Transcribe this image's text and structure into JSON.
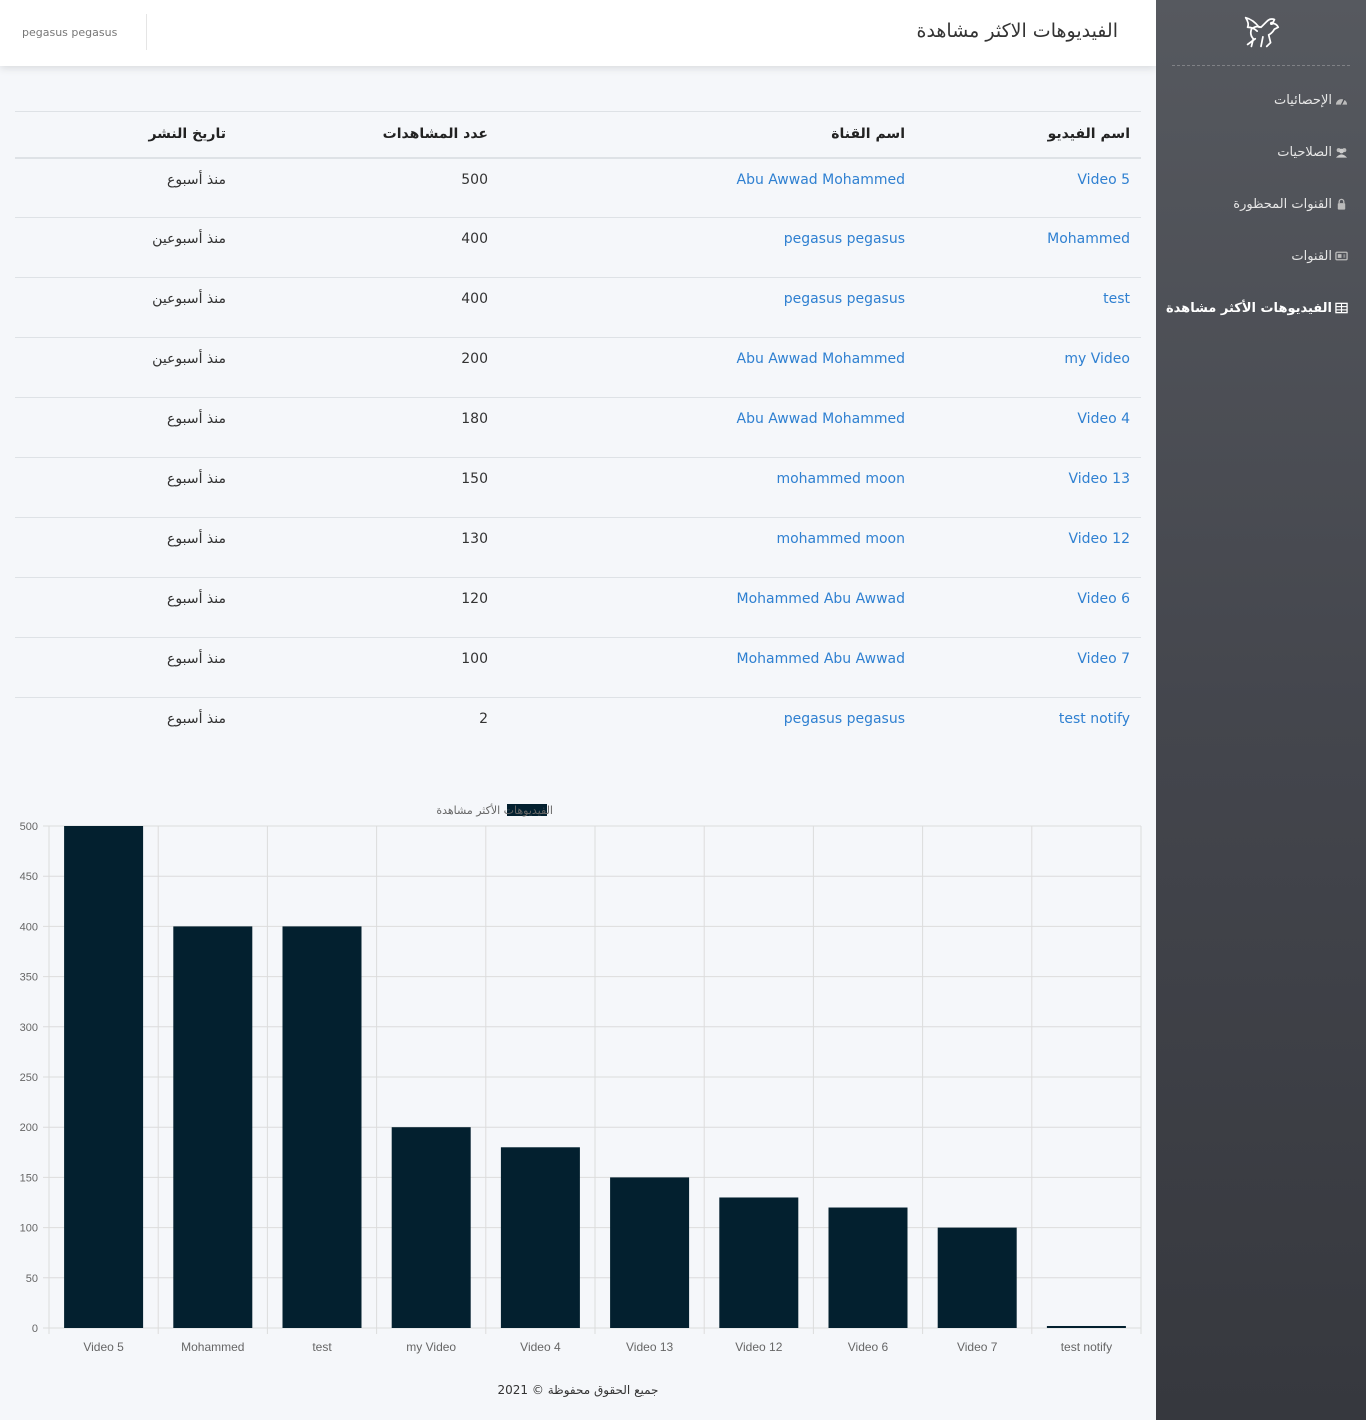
{
  "header": {
    "title": "الفيديوهات الاكثر مشاهدة",
    "user": "pegasus pegasus"
  },
  "sidebar": {
    "items": [
      {
        "label": "الإحصائيات",
        "icon": "dashboard-icon",
        "active": false
      },
      {
        "label": "الصلاحيات",
        "icon": "users-icon",
        "active": false
      },
      {
        "label": "القنوات المحظورة",
        "icon": "lock-icon",
        "active": false
      },
      {
        "label": "القنوات",
        "icon": "tv-icon",
        "active": false
      },
      {
        "label": "الفيديوهات الأكثر مشاهدة",
        "icon": "table-icon",
        "active": true
      }
    ]
  },
  "table": {
    "headers": [
      "اسم الفيديو",
      "اسم القناة",
      "عدد المشاهدات",
      "تاريخ النشر"
    ],
    "rows": [
      {
        "video": "Video 5",
        "channel": "Abu Awwad Mohammed",
        "views": "500",
        "date": "منذ أسبوع"
      },
      {
        "video": "Mohammed",
        "channel": "pegasus pegasus",
        "views": "400",
        "date": "منذ أسبوعين"
      },
      {
        "video": "test",
        "channel": "pegasus pegasus",
        "views": "400",
        "date": "منذ أسبوعين"
      },
      {
        "video": "my Video",
        "channel": "Abu Awwad Mohammed",
        "views": "200",
        "date": "منذ أسبوعين"
      },
      {
        "video": "Video 4",
        "channel": "Abu Awwad Mohammed",
        "views": "180",
        "date": "منذ أسبوع"
      },
      {
        "video": "Video 13",
        "channel": "mohammed moon",
        "views": "150",
        "date": "منذ أسبوع"
      },
      {
        "video": "Video 12",
        "channel": "mohammed moon",
        "views": "130",
        "date": "منذ أسبوع"
      },
      {
        "video": "Video 6",
        "channel": "Mohammed Abu Awwad",
        "views": "120",
        "date": "منذ أسبوع"
      },
      {
        "video": "Video 7",
        "channel": "Mohammed Abu Awwad",
        "views": "100",
        "date": "منذ أسبوع"
      },
      {
        "video": "test notify",
        "channel": "pegasus pegasus",
        "views": "2",
        "date": "منذ أسبوع"
      }
    ]
  },
  "chart_data": {
    "type": "bar",
    "categories": [
      "Video 5",
      "Mohammed",
      "test",
      "my Video",
      "Video 4",
      "Video 13",
      "Video 12",
      "Video 6",
      "Video 7",
      "test notify"
    ],
    "series": [
      {
        "name": "الفيديوهات الأكثر مشاهدة",
        "values": [
          500,
          400,
          400,
          200,
          180,
          150,
          130,
          120,
          100,
          2
        ],
        "color": "#03202f"
      }
    ],
    "ylim": [
      0,
      500
    ],
    "yticks": [
      0,
      50,
      100,
      150,
      200,
      250,
      300,
      350,
      400,
      450,
      500
    ],
    "grid": true,
    "legend": "top-center"
  },
  "footer": {
    "text": "جميع الحقوق محفوظة © 2021"
  },
  "colors": {
    "link": "#2f80d1",
    "bar": "#03202f",
    "sidebar": "#44464d"
  }
}
